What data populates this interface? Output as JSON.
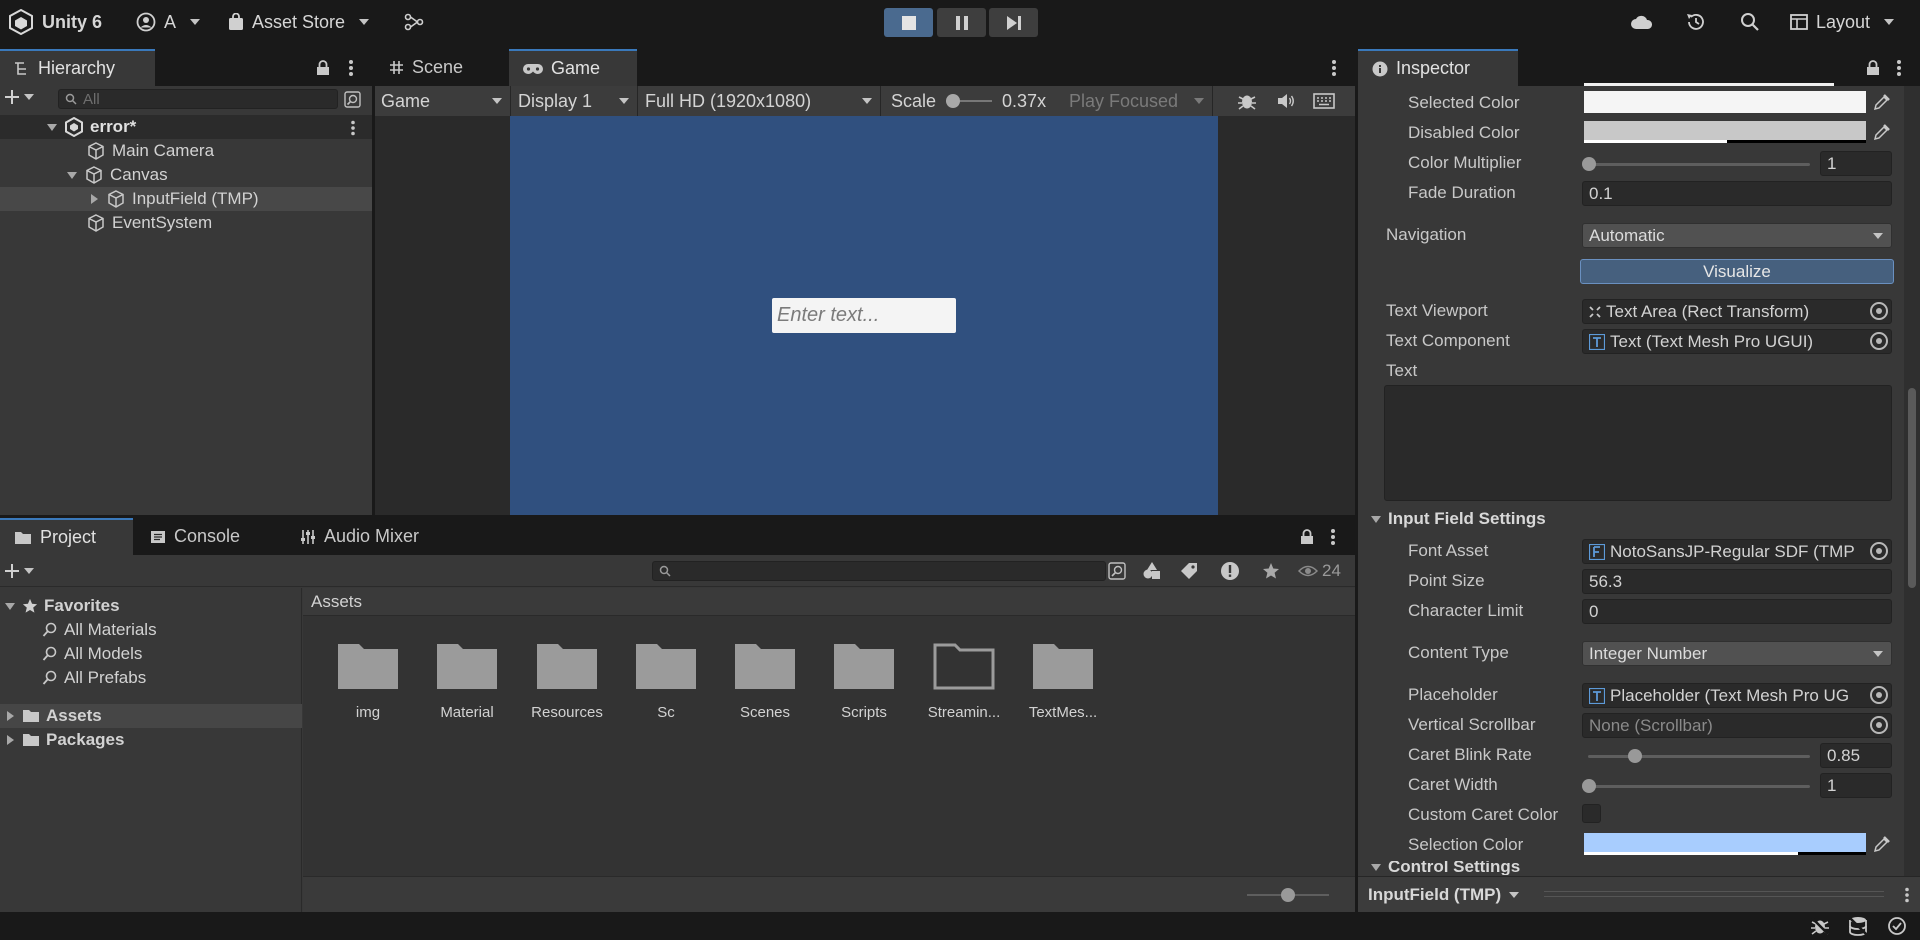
{
  "toolbar": {
    "app_title": "Unity 6",
    "account": "A",
    "asset_store": "Asset Store",
    "layout": "Layout"
  },
  "hierarchy": {
    "tab": "Hierarchy",
    "search_placeholder": "All",
    "scene": "error*",
    "items": [
      "Main Camera",
      "Canvas",
      "InputField (TMP)",
      "EventSystem"
    ]
  },
  "sceneview": {
    "tab_scene": "Scene",
    "tab_game": "Game",
    "game_mode": "Game",
    "display": "Display 1",
    "resolution": "Full HD (1920x1080)",
    "scale_label": "Scale",
    "scale_value": "0.37x",
    "play_focused": "Play Focused",
    "input_placeholder": "Enter text..."
  },
  "project": {
    "tab_project": "Project",
    "tab_console": "Console",
    "tab_audio": "Audio Mixer",
    "hidden_count": "24",
    "favorites": "Favorites",
    "fav_items": [
      "All Materials",
      "All Models",
      "All Prefabs"
    ],
    "roots": [
      "Assets",
      "Packages"
    ],
    "breadcrumb": "Assets",
    "assets": [
      "img",
      "Material",
      "Resources",
      "Sc",
      "Scenes",
      "Scripts",
      "Streamin...",
      "TextMes..."
    ]
  },
  "inspector": {
    "tab": "Inspector",
    "selected_color": "Selected Color",
    "disabled_color": "Disabled Color",
    "color_multiplier": "Color Multiplier",
    "color_multiplier_value": "1",
    "fade_duration": "Fade Duration",
    "fade_duration_value": "0.1",
    "navigation": "Navigation",
    "navigation_value": "Automatic",
    "visualize": "Visualize",
    "text_viewport": "Text Viewport",
    "text_viewport_value": "Text Area (Rect Transform)",
    "text_component": "Text Component",
    "text_component_value": "Text (Text Mesh Pro UGUI)",
    "text": "Text",
    "input_field_settings": "Input Field Settings",
    "font_asset": "Font Asset",
    "font_asset_value": "NotoSansJP-Regular SDF (TMP",
    "point_size": "Point Size",
    "point_size_value": "56.3",
    "character_limit": "Character Limit",
    "character_limit_value": "0",
    "content_type": "Content Type",
    "content_type_value": "Integer Number",
    "placeholder": "Placeholder",
    "placeholder_value": "Placeholder (Text Mesh Pro UG",
    "vertical_scrollbar": "Vertical Scrollbar",
    "vertical_scrollbar_value": "None (Scrollbar)",
    "caret_blink_rate": "Caret Blink Rate",
    "caret_blink_rate_value": "0.85",
    "caret_width": "Caret Width",
    "caret_width_value": "1",
    "custom_caret_color": "Custom Caret Color",
    "selection_color": "Selection Color",
    "control_settings": "Control Settings",
    "footer_object": "InputField (TMP)",
    "colors": {
      "selected": "#f5f5f5",
      "disabled": "#c8c8c8",
      "selection": "#a8cdfe"
    }
  }
}
